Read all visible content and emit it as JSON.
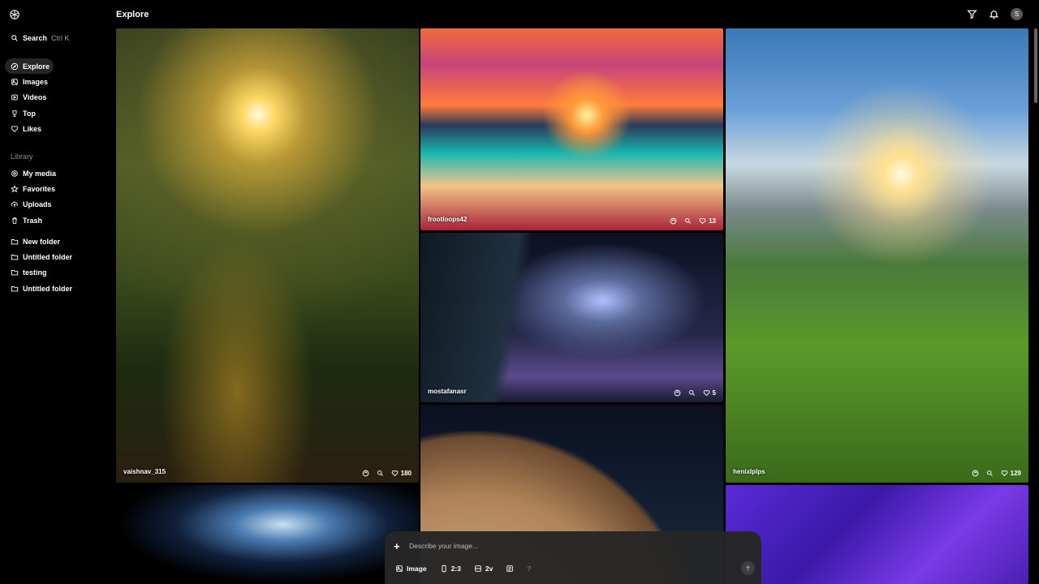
{
  "header": {
    "title": "Explore",
    "avatar_initial": "S"
  },
  "search": {
    "label": "Search",
    "shortcut": "Ctrl K"
  },
  "nav": [
    {
      "label": "Explore",
      "icon": "compass-icon"
    },
    {
      "label": "Images",
      "icon": "image-icon"
    },
    {
      "label": "Videos",
      "icon": "video-icon"
    },
    {
      "label": "Top",
      "icon": "trophy-icon"
    },
    {
      "label": "Likes",
      "icon": "heart-icon"
    }
  ],
  "library": {
    "label": "Library",
    "items": [
      {
        "label": "My media"
      },
      {
        "label": "Favorites"
      },
      {
        "label": "Uploads"
      },
      {
        "label": "Trash"
      }
    ],
    "folders": [
      {
        "label": "New folder"
      },
      {
        "label": "Untitled folder"
      },
      {
        "label": "testing"
      },
      {
        "label": "Untitled folder"
      }
    ]
  },
  "cards": {
    "forest": {
      "user": "vaishnav_315",
      "likes": "180"
    },
    "beach": {
      "user": "frootloops42",
      "likes": "13"
    },
    "corridor": {
      "user": "mostafanasr",
      "likes": "5"
    },
    "meadow": {
      "user": "henixlplps",
      "likes": "129"
    }
  },
  "prompt": {
    "placeholder": "Describe your image...",
    "mode": "Image",
    "ratio": "2:3",
    "variations": "2v",
    "help": "?"
  },
  "colors": {
    "background": "#000000",
    "active_nav": "#262626",
    "prompt_bg": "#262626"
  }
}
